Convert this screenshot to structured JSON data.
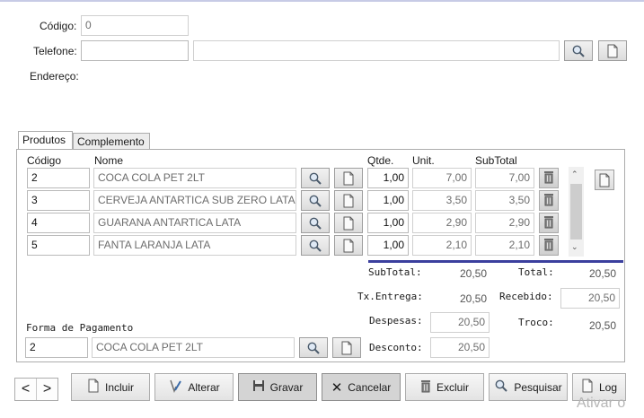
{
  "header": {
    "codigo_label": "Código:",
    "codigo_value": "0",
    "telefone_label": "Telefone:",
    "telefone_value": "",
    "nome_value": "",
    "endereco_label": "Endereço:"
  },
  "tabs": [
    {
      "label": "Produtos",
      "active": true
    },
    {
      "label": "Complemento",
      "active": false
    }
  ],
  "grid": {
    "columns": {
      "codigo": "Código",
      "nome": "Nome",
      "qtde": "Qtde.",
      "unit": "Unit.",
      "subtotal": "SubTotal"
    },
    "rows": [
      {
        "codigo": "2",
        "nome": "COCA COLA PET 2LT",
        "qtde": "1,00",
        "unit": "7,00",
        "subtotal": "7,00"
      },
      {
        "codigo": "3",
        "nome": "CERVEJA ANTARTICA SUB ZERO LATA",
        "qtde": "1,00",
        "unit": "3,50",
        "subtotal": "3,50"
      },
      {
        "codigo": "4",
        "nome": "GUARANA ANTARTICA LATA",
        "qtde": "1,00",
        "unit": "2,90",
        "subtotal": "2,90"
      },
      {
        "codigo": "5",
        "nome": "FANTA LARANJA LATA",
        "qtde": "1,00",
        "unit": "2,10",
        "subtotal": "2,10"
      }
    ]
  },
  "totals": {
    "subtotal_label": "SubTotal:",
    "subtotal_value": "20,50",
    "total_label": "Total:",
    "total_value": "20,50",
    "txentrega_label": "Tx.Entrega:",
    "txentrega_value": "20,50",
    "recebido_label": "Recebido:",
    "recebido_value": "20,50",
    "despesas_label": "Despesas:",
    "despesas_value": "20,50",
    "troco_label": "Troco:",
    "troco_value": "20,50",
    "desconto_label": "Desconto:",
    "desconto_value": "20,50"
  },
  "pagamento": {
    "label": "Forma de Pagamento",
    "codigo": "2",
    "nome": "COCA COLA PET 2LT"
  },
  "toolbar": {
    "prev": "<",
    "next": ">",
    "incluir": "Incluir",
    "alterar": "Alterar",
    "gravar": "Gravar",
    "cancelar": "Cancelar",
    "excluir": "Excluir",
    "pesquisar": "Pesquisar",
    "log": "Log"
  },
  "watermark": "Ativar o"
}
